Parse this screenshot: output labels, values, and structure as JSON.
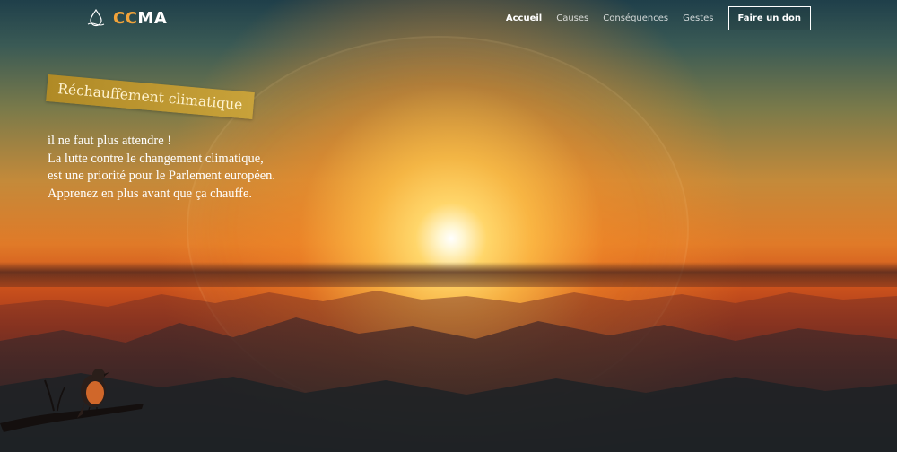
{
  "brand": {
    "accent_text": "CC",
    "rest_text": "MA",
    "icon": "water-drop-icon",
    "accent_color": "#f2a33a"
  },
  "nav": {
    "items": [
      {
        "label": "Accueil",
        "active": true
      },
      {
        "label": "Causes",
        "active": false
      },
      {
        "label": "Conséquences",
        "active": false
      },
      {
        "label": "Gestes",
        "active": false
      }
    ],
    "cta_label": "Faire un don"
  },
  "hero": {
    "tag": "Réchauffement climatique",
    "lines": [
      "il ne faut plus attendre !",
      "La lutte contre le changement climatique,",
      "est une priorité pour le Parlement européen.",
      "Apprenez en plus avant que ça chauffe."
    ],
    "tag_color": "#b08a26"
  }
}
